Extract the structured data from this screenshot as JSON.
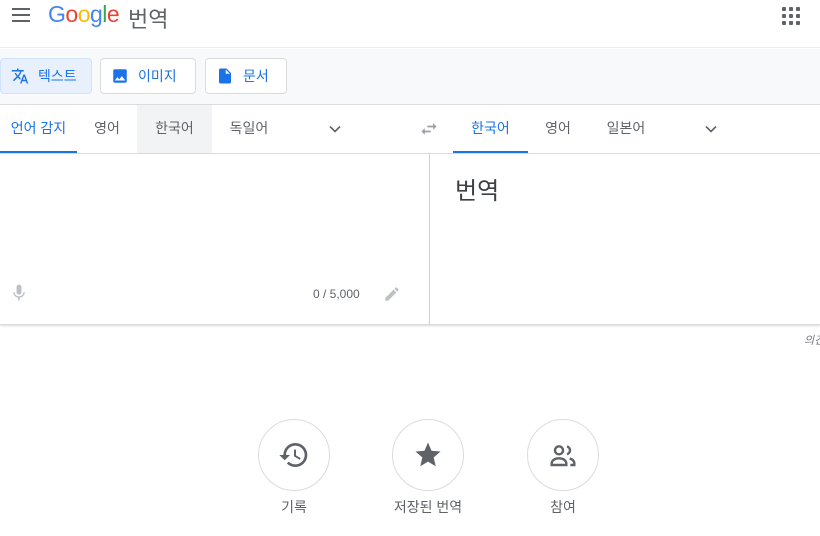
{
  "header": {
    "logo_letters": [
      "G",
      "o",
      "o",
      "g",
      "l",
      "e"
    ],
    "app_name": "번역",
    "menu_icon": "hamburger-menu-icon",
    "apps_icon": "apps-grid-icon"
  },
  "modes": [
    {
      "label": "텍스트",
      "icon": "translate-icon",
      "active": true
    },
    {
      "label": "이미지",
      "icon": "image-icon",
      "active": false
    },
    {
      "label": "문서",
      "icon": "document-icon",
      "active": false
    }
  ],
  "source_languages": [
    {
      "label": "언어 감지",
      "selected": true
    },
    {
      "label": "영어",
      "selected": false
    },
    {
      "label": "한국어",
      "selected": false,
      "hovered": true
    },
    {
      "label": "독일어",
      "selected": false
    }
  ],
  "target_languages": [
    {
      "label": "한국어",
      "selected": true
    },
    {
      "label": "영어",
      "selected": false
    },
    {
      "label": "일본어",
      "selected": false
    }
  ],
  "source": {
    "value": "",
    "char_count": "0 / 5,000"
  },
  "target": {
    "placeholder_text": "번역"
  },
  "feedback_label": "의견",
  "bottom_actions": [
    {
      "label": "기록",
      "icon": "history-icon"
    },
    {
      "label": "저장된 번역",
      "icon": "star-icon"
    },
    {
      "label": "참여",
      "icon": "people-icon"
    }
  ],
  "colors": {
    "accent": "#1a73e8",
    "text": "#3c4043",
    "muted": "#5f6368",
    "border": "#dadce0",
    "active_mode_bg": "#e8f0fe"
  }
}
